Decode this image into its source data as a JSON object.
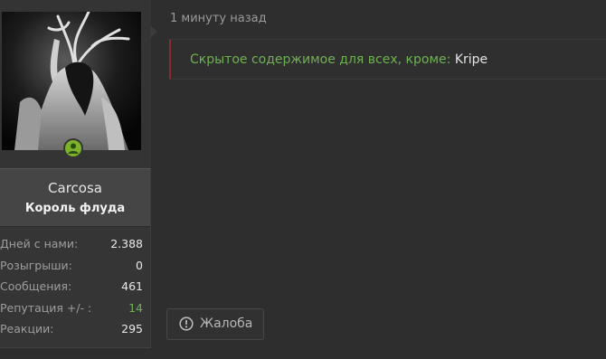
{
  "user": {
    "name": "Carcosa",
    "title": "Король флуда",
    "status": "online"
  },
  "stats": [
    {
      "label": "Дней с нами:",
      "value": "2.388",
      "color": "#e8e8e8"
    },
    {
      "label": "Розыгрыши:",
      "value": "0",
      "color": "#e8e8e8"
    },
    {
      "label": "Сообщения:",
      "value": "461",
      "color": "#e8e8e8"
    },
    {
      "label": "Репутация +/- :",
      "value": "14",
      "color": "#6fb152"
    },
    {
      "label": "Реакции:",
      "value": "295",
      "color": "#e8e8e8"
    }
  ],
  "post": {
    "time": "1 минуту назад",
    "hidden_prefix": "Скрытое содержимое для всех, кроме:",
    "hidden_user": "Kripe"
  },
  "actions": {
    "report_label": "Жалоба",
    "report_icon": "exclamation-circle-icon"
  },
  "colors": {
    "accent_green": "#6fb152",
    "online_green": "#7cb32a",
    "hidden_border": "#8c2b2b",
    "background": "#2e2e2e"
  }
}
